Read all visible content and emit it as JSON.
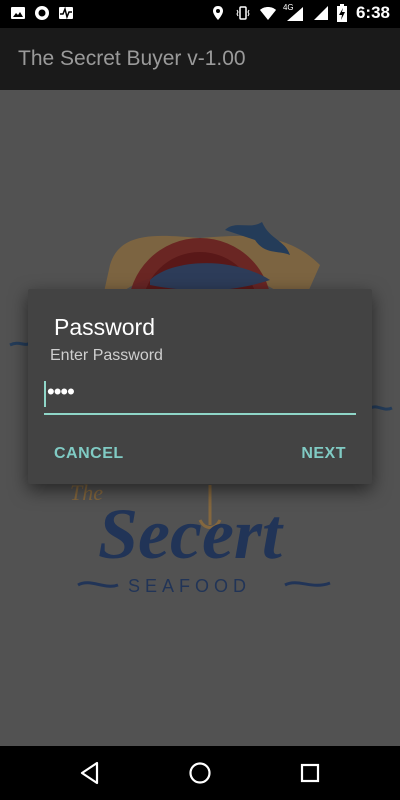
{
  "status_bar": {
    "time": "6:38",
    "network_type": "4G",
    "icons": [
      "image-icon",
      "circle-record-icon",
      "activity-icon",
      "location-icon",
      "vibrate-icon",
      "wifi-icon",
      "signal-icon",
      "battery-charging-icon"
    ]
  },
  "app_bar": {
    "title": "The Secret Buyer v-1.00"
  },
  "logo": {
    "brand_text": "Secert",
    "prefix_text": "The",
    "sub_text": "SEAFOOD"
  },
  "dialog": {
    "title": "Password",
    "message": "Enter Password",
    "password_value": "••••",
    "cancel_label": "CANCEL",
    "next_label": "NEXT"
  },
  "nav_bar": {
    "buttons": [
      "back-icon",
      "home-icon",
      "recents-icon"
    ]
  },
  "colors": {
    "accent": "#80cbc4",
    "dialog_bg": "#434343",
    "scrim_bg": "#525252",
    "appbar_bg": "#1a1a1a"
  }
}
